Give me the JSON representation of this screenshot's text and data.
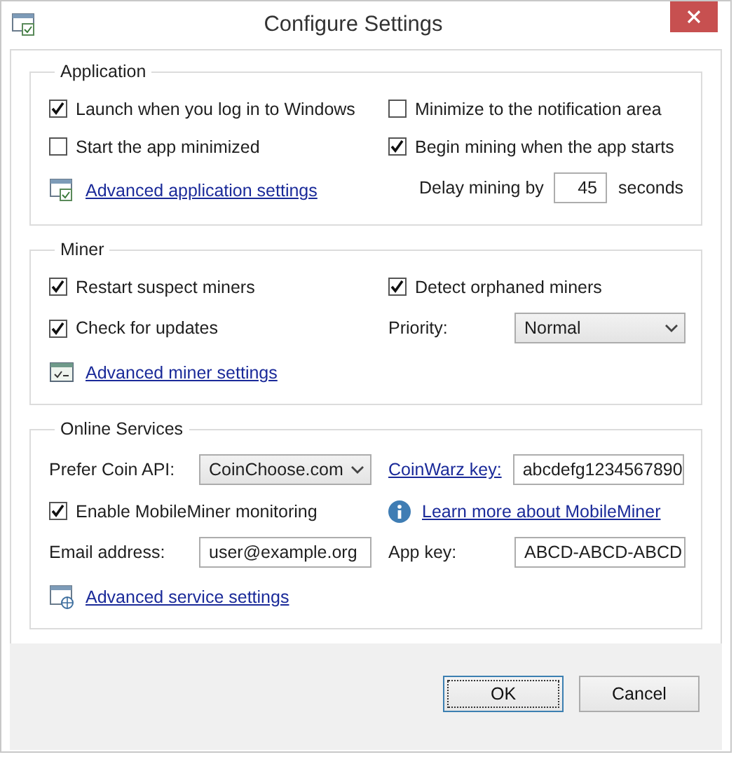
{
  "window": {
    "title": "Configure Settings"
  },
  "sections": [
    {
      "title": "Application",
      "rows": [
        [
          {
            "kind": "checkbox",
            "label": "Launch when you log in to Windows",
            "checked": true
          },
          {
            "kind": "checkbox",
            "label": "Minimize to the notification area",
            "checked": false
          }
        ],
        [
          {
            "kind": "checkbox",
            "label": "Start the app minimized",
            "checked": false
          },
          {
            "kind": "checkbox",
            "label": "Begin mining when the app starts",
            "checked": true
          }
        ],
        [
          {
            "kind": "link",
            "label": "Advanced application settings"
          },
          {
            "kind": "number",
            "label": "Delay mining by",
            "value": "45",
            "suffix": "seconds"
          }
        ]
      ]
    },
    {
      "title": "Miner",
      "rows": [
        [
          {
            "kind": "checkbox",
            "label": "Restart suspect miners",
            "checked": true
          },
          {
            "kind": "checkbox",
            "label": "Detect orphaned miners",
            "checked": true
          }
        ],
        [
          {
            "kind": "checkbox",
            "label": "Check for updates",
            "checked": true
          },
          {
            "kind": "select",
            "label": "Priority:",
            "value": "Normal"
          }
        ],
        [
          {
            "kind": "link",
            "label": "Advanced miner settings"
          }
        ]
      ]
    },
    {
      "title": "Online Services",
      "rows": [
        [
          {
            "kind": "select",
            "label": "Prefer Coin API:",
            "value": "CoinChoose.com"
          },
          {
            "kind": "linkfield",
            "label": "CoinWarz key:",
            "value": "abcdefg1234567890"
          }
        ],
        [
          {
            "kind": "checkbox",
            "label": "Enable MobileMiner monitoring",
            "checked": true
          },
          {
            "kind": "infolink",
            "label": "Learn more about MobileMiner"
          }
        ],
        [
          {
            "kind": "text",
            "label": "Email address:",
            "value": "user@example.org"
          },
          {
            "kind": "text",
            "label": "App key:",
            "value": "ABCD-ABCD-ABCD"
          }
        ],
        [
          {
            "kind": "link",
            "label": "Advanced service settings"
          }
        ]
      ]
    }
  ],
  "buttons": [
    {
      "label": "OK",
      "focused": true
    },
    {
      "label": "Cancel",
      "focused": false
    }
  ]
}
